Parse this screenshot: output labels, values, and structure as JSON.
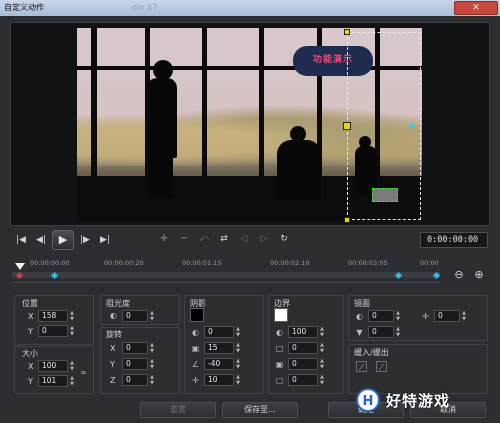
{
  "window": {
    "title": "自定义动作",
    "faded_title": "dio X7",
    "close_glyph": "✕"
  },
  "preview": {
    "overlay_title": "功能演示"
  },
  "transport": {
    "timecode": "0:00:00:00",
    "buttons": [
      "to-start",
      "prev-frame",
      "play",
      "next-frame",
      "to-end"
    ]
  },
  "ruler": {
    "ticks": [
      "00:00:00:00",
      "00:00:00:20",
      "00:00:01:15",
      "00:00:02:10",
      "00:00:03:05",
      "00:00"
    ]
  },
  "position": {
    "label": "位置",
    "x": "158",
    "y": "0"
  },
  "size": {
    "label": "大小",
    "x": "100",
    "y": "101"
  },
  "opacity": {
    "label": "阻光度",
    "value": "0"
  },
  "rotate": {
    "label": "旋转",
    "x": "0",
    "y": "0",
    "z": "0"
  },
  "shadow": {
    "label": "阴影",
    "v1": "0",
    "v2": "15",
    "v3": "-40",
    "v4": "10"
  },
  "border": {
    "label": "边界",
    "v1": "100",
    "v2": "0",
    "v3": "0",
    "v4": "0"
  },
  "mirror": {
    "label": "镜面",
    "v1": "0",
    "v2": "0",
    "v3": "0"
  },
  "fade": {
    "label": "缓入/缓出"
  },
  "footer": {
    "reset": "重置",
    "save_to": "保存至...",
    "ok": "确定",
    "cancel": "取消"
  },
  "axes": {
    "x": "X",
    "y": "Y",
    "z": "Z"
  },
  "watermark": {
    "logo_letter": "H",
    "text": "好特游戏"
  },
  "colors": {
    "shadow_swatch": "#000000",
    "border_swatch": "#ffffff",
    "keyframe": "#33b8e6",
    "handle": "#e6d800"
  }
}
